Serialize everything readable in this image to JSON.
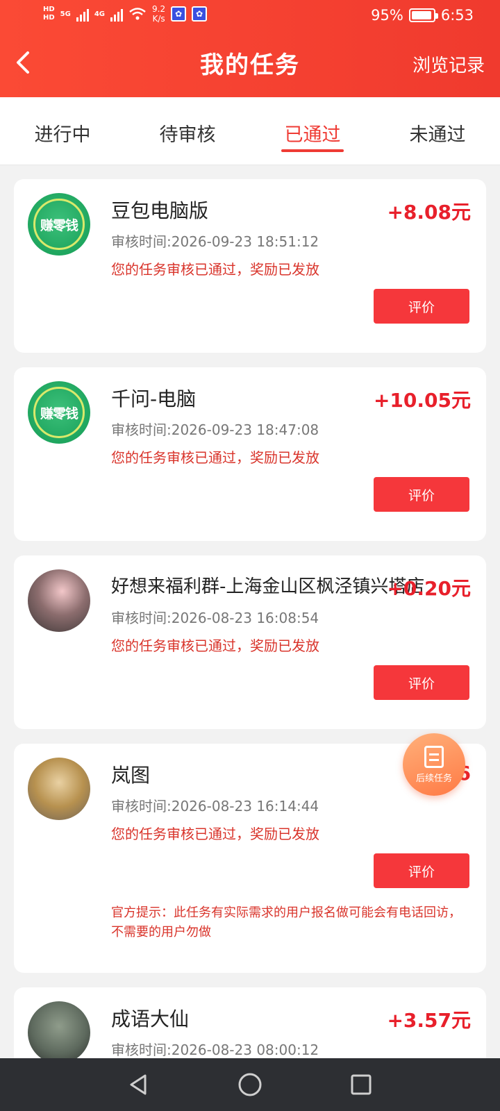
{
  "status_bar": {
    "hd1": "HD",
    "hd2": "HD",
    "net1": "5G",
    "net2": "4G",
    "speed_value": "9.2",
    "speed_unit": "K/s",
    "battery": "95%",
    "battery_level": 0.95,
    "time": "6:53"
  },
  "header": {
    "title": "我的任务",
    "right_link": "浏览记录"
  },
  "tabs": [
    {
      "label": "进行中",
      "active": false
    },
    {
      "label": "待审核",
      "active": false
    },
    {
      "label": "已通过",
      "active": true
    },
    {
      "label": "未通过",
      "active": false
    }
  ],
  "tasks": [
    {
      "name": "豆包电脑版",
      "reward": "+8.08元",
      "review_time": "审核时间:2026-09-23 18:51:12",
      "status_msg": "您的任务审核已通过，奖励已发放",
      "button": "评价",
      "avatar_text": "赚零钱"
    },
    {
      "name": "千问-电脑",
      "reward": "+10.05元",
      "review_time": "审核时间:2026-09-23 18:47:08",
      "status_msg": "您的任务审核已通过，奖励已发放",
      "button": "评价",
      "avatar_text": "赚零钱"
    },
    {
      "name": "好想来福利群-上海金山区枫泾镇兴塔店",
      "reward": "+0.20元",
      "review_time": "审核时间:2026-08-23 16:08:54",
      "status_msg": "您的任务审核已通过，奖励已发放",
      "button": "评价"
    },
    {
      "name": "岚图",
      "reward": "+6",
      "review_time": "审核时间:2026-08-23 16:14:44",
      "status_msg": "您的任务审核已通过，奖励已发放",
      "button": "评价",
      "notice": "官方提示：此任务有实际需求的用户报名做可能会有电话回访，不需要的用户勿做"
    },
    {
      "name": "成语大仙",
      "reward": "+3.57元",
      "review_time": "审核时间:2026-08-23 08:00:12"
    }
  ],
  "fab": {
    "label": "后续任务"
  },
  "colors": {
    "brand_red": "#f03a2e",
    "reward_red": "#e8202b",
    "button_red": "#f5373b"
  }
}
